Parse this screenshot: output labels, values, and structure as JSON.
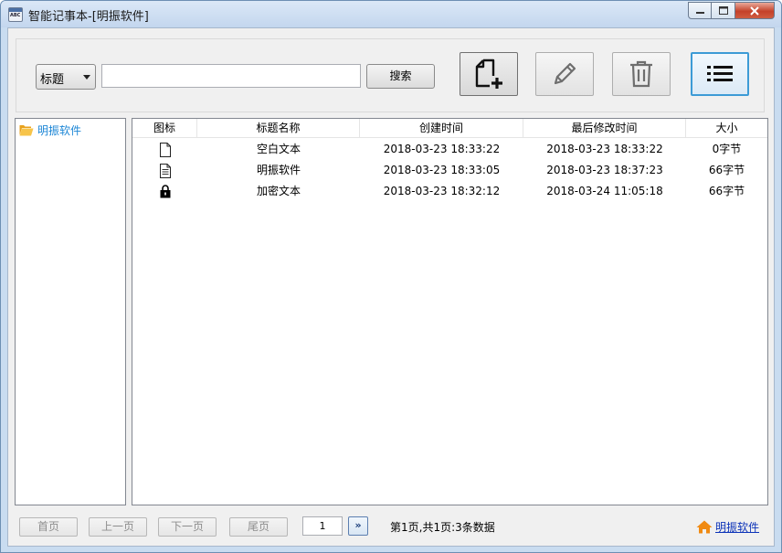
{
  "window": {
    "title": "智能记事本-[明振软件]",
    "app_icon_text": "ABC"
  },
  "toolbar": {
    "search_field_selected": "标题",
    "search_input_value": "",
    "search_label": "搜索",
    "accent_color": "#3c9bd6"
  },
  "tree": {
    "items": [
      {
        "label": "明振软件",
        "icon": "folder-open-icon",
        "color": "#1c86d6"
      }
    ]
  },
  "list": {
    "columns": [
      "图标",
      "标题名称",
      "创建时间",
      "最后修改时间",
      "大小"
    ],
    "rows": [
      {
        "icon": "blank-document-icon",
        "title": "空白文本",
        "created": "2018-03-23  18:33:22",
        "modified": "2018-03-23  18:33:22",
        "size": "0字节"
      },
      {
        "icon": "text-document-icon",
        "title": "明振软件",
        "created": "2018-03-23  18:33:05",
        "modified": "2018-03-23  18:37:23",
        "size": "66字节"
      },
      {
        "icon": "lock-icon",
        "title": "加密文本",
        "created": "2018-03-23  18:32:12",
        "modified": "2018-03-24  11:05:18",
        "size": "66字节"
      }
    ]
  },
  "pager": {
    "first": "首页",
    "prev": "上一页",
    "next": "下一页",
    "last": "尾页",
    "page_input": "1",
    "go": "»",
    "info": "第1页,共1页:3条数据"
  },
  "footer": {
    "link": "明振软件",
    "link_color": "#0b32b8",
    "icon": "home-icon"
  }
}
